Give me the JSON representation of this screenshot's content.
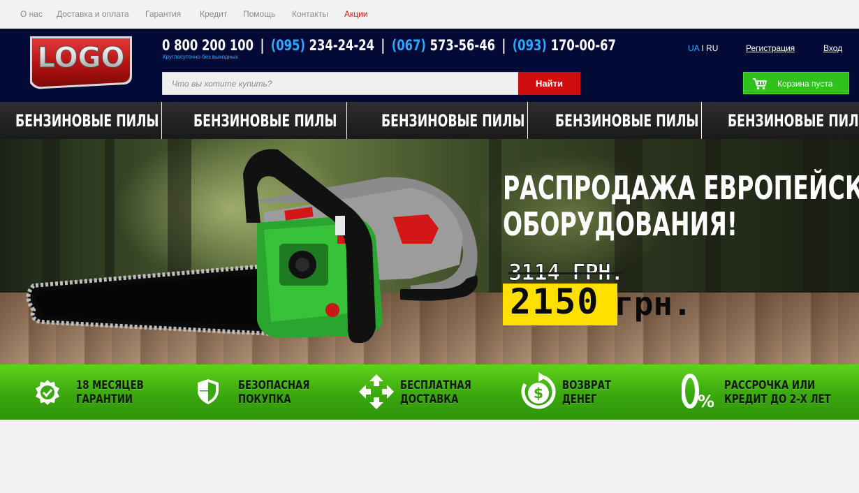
{
  "top_nav": {
    "links": [
      {
        "label": "О нас"
      },
      {
        "label": "Доставка и оплата"
      },
      {
        "label": "Гарантия"
      },
      {
        "label": "Кредит"
      },
      {
        "label": "Помощь"
      },
      {
        "label": "Контакты"
      },
      {
        "label": "Акции"
      }
    ]
  },
  "header": {
    "logo_text": "LOGO",
    "phones": [
      {
        "code": "",
        "number": "0 800 200 100"
      },
      {
        "code": "(095)",
        "number": "234-24-24"
      },
      {
        "code": "(067)",
        "number": "573-56-46"
      },
      {
        "code": "(093)",
        "number": "170-00-67"
      }
    ],
    "phone_separator": "|",
    "hours_note": "Круглосуточно без выходных",
    "search": {
      "placeholder": "Что вы хотите купить?",
      "button_label": "Найти"
    },
    "lang": {
      "ua": "UA",
      "sep": "I",
      "ru": "RU"
    },
    "register_label": "Регистрация",
    "login_label": "Вход",
    "cart_label": "Корзина пуста"
  },
  "category_menu": {
    "items": [
      {
        "label": "БЕНЗИНОВЫЕ ПИЛЫ"
      },
      {
        "label": "БЕНЗИНОВЫЕ ПИЛЫ"
      },
      {
        "label": "БЕНЗИНОВЫЕ ПИЛЫ"
      },
      {
        "label": "БЕНЗИНОВЫЕ ПИЛЫ"
      },
      {
        "label": "БЕНЗИНОВЫЕ ПИЛЫ"
      }
    ]
  },
  "banner": {
    "title_line1": "РАСПРОДАЖА ЕВРОПЕЙСКОГО",
    "title_line2": "ОБОРУДОВАНИЯ!",
    "old_price": "3114 ГРН.",
    "new_price": "2150",
    "currency": "грн."
  },
  "features": [
    {
      "icon": "guarantee-badge-icon",
      "line1": "18 МЕСЯЦЕВ",
      "line2": "ГАРАНТИИ"
    },
    {
      "icon": "shield-icon",
      "line1": "БЕЗОПАСНАЯ",
      "line2": "ПОКУПКА"
    },
    {
      "icon": "delivery-arrows-icon",
      "line1": "БЕСПЛАТНАЯ",
      "line2": "ДОСТАВКА"
    },
    {
      "icon": "money-back-icon",
      "line1": "ВОЗВРАТ",
      "line2": "ДЕНЕГ"
    },
    {
      "icon": "zero-percent-icon",
      "line1": "РАССРОЧКА ИЛИ",
      "line2": "КРЕДИТ ДО 2-Х ЛЕТ"
    }
  ],
  "colors": {
    "header_bg": "#020a35",
    "accent_blue": "#2aa7ff",
    "search_button": "#d10e0e",
    "cart_green": "#2fc21c",
    "promo_red": "#e41414",
    "price_yellow": "#ffe000",
    "features_green": "#3aa80e"
  }
}
